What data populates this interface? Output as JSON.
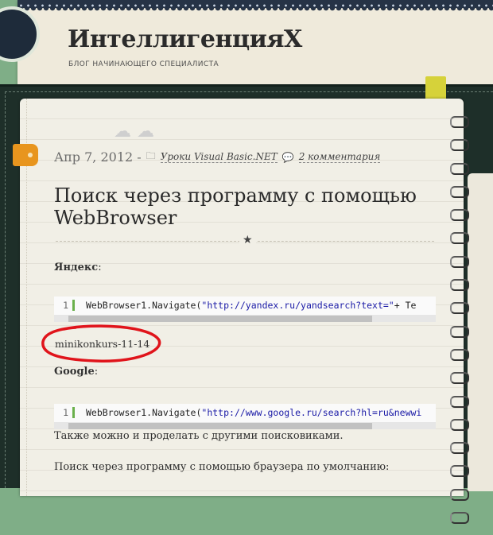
{
  "site": {
    "title": "ИнтеллигенцияХ",
    "tagline": "БЛОГ НАЧИНАЮЩЕГО СПЕЦИАЛИСТА"
  },
  "post": {
    "date": "Апр 7, 2012 -",
    "category": "Уроки Visual Basic.NET",
    "comments": "2 комментария",
    "title": "Поиск через программу с помощью WebBrowser",
    "yandex_label": "Яндекс",
    "code1": {
      "line_number": "1",
      "prefix": "WebBrowser1.Navigate(",
      "string": "\"http://yandex.ru/yandsearch?text=\"",
      "suffix": " + Te"
    },
    "watermark": "minikonkurs-11-14",
    "google_label": "Google",
    "code2": {
      "line_number": "1",
      "prefix": "WebBrowser1.Navigate(",
      "string": "\"http://www.google.ru/search?hl=ru&newwi"
    },
    "para1": "Также можно и проделать с другими поисковиками.",
    "para2": "Поиск через программу с помощью браузера по умолчанию:"
  },
  "colors": {
    "background": "#7fae87",
    "cover": "#1e2f29",
    "page": "#f1efe6",
    "tab": "#e8951e",
    "bookmark": "#d6d23a",
    "annotation": "#e0141b",
    "code_string": "#1a1aa6"
  }
}
